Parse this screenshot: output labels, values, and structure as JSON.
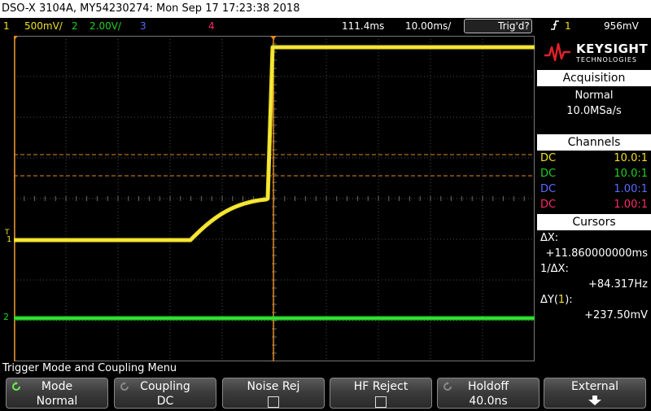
{
  "title_bar": {
    "text": "DSO-X 3104A, MY54230274: Mon Sep 17 17:23:38 2018"
  },
  "status": {
    "ch1_num": "1",
    "ch1_scale": "500mV/",
    "ch2_num": "2",
    "ch2_scale": "2.00V/",
    "ch3_num": "3",
    "ch4_num": "4",
    "time_delay": "111.4ms",
    "time_scale": "10.00ms/",
    "trigger_state": "Trig'd?",
    "trig_icon": "rising-edge-icon",
    "trig_source": "1",
    "trig_level": "956mV"
  },
  "colors": {
    "ch1": "#f0e020",
    "ch2": "#20d020",
    "ch3": "#5a6bff",
    "ch4": "#ff2a6a",
    "cursor": "#e08a20"
  },
  "brand": {
    "name": "KEYSIGHT",
    "sub": "TECHNOLOGIES"
  },
  "acquisition": {
    "header": "Acquisition",
    "mode": "Normal",
    "rate": "10.0MSa/s"
  },
  "channels": {
    "header": "Channels",
    "rows": [
      {
        "coupling": "DC",
        "probe": "10.0:1"
      },
      {
        "coupling": "DC",
        "probe": "10.0:1"
      },
      {
        "coupling": "DC",
        "probe": "1.00:1"
      },
      {
        "coupling": "DC",
        "probe": "1.00:1"
      }
    ]
  },
  "cursors": {
    "header": "Cursors",
    "dx_label": "ΔX:",
    "dx_value": "+11.860000000ms",
    "inv_label": "1/ΔX:",
    "inv_value": "+84.317Hz",
    "dy_label": "ΔY(",
    "dy_ch": "1",
    "dy_close": "):",
    "dy_value": "+237.50mV"
  },
  "markers": {
    "trig": "T",
    "ch1": "1",
    "ch2": "2"
  },
  "menu": {
    "title": "Trigger Mode and Coupling Menu"
  },
  "softkeys": [
    {
      "label": "Mode",
      "value": "Normal"
    },
    {
      "label": "Coupling",
      "value": "DC"
    },
    {
      "label": "Noise Rej",
      "value": ""
    },
    {
      "label": "HF Reject",
      "value": ""
    },
    {
      "label": "Holdoff",
      "value": "40.0ns"
    },
    {
      "label": "External",
      "value": ""
    }
  ]
}
